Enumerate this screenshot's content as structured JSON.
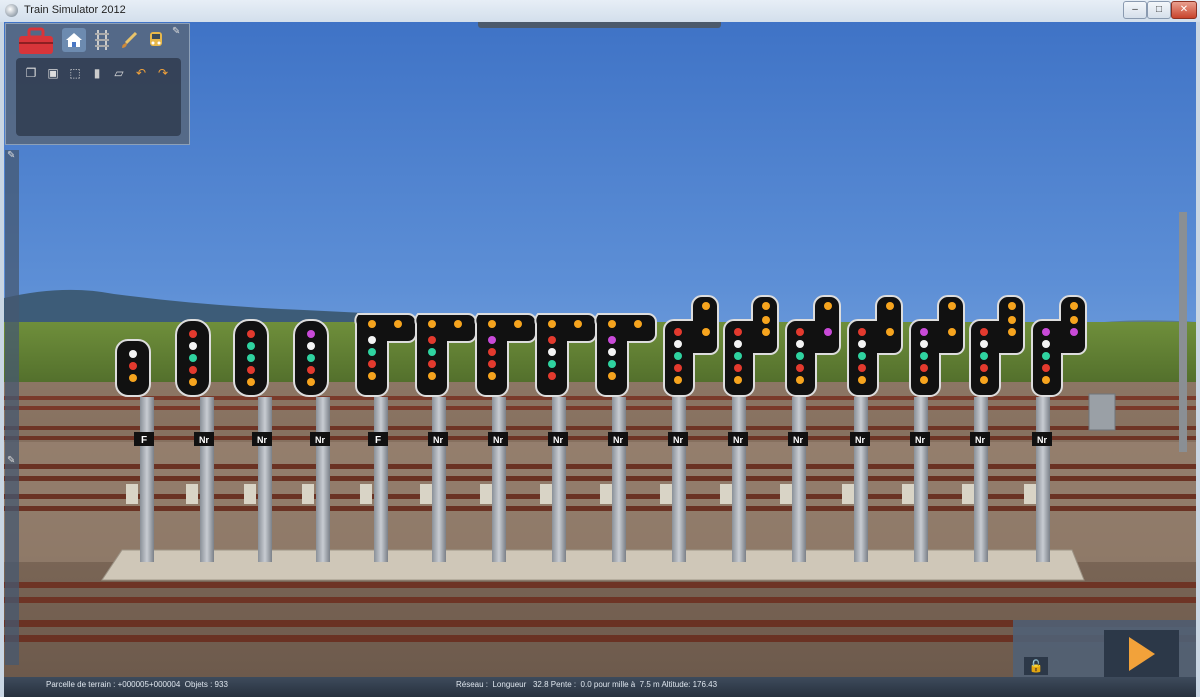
{
  "window": {
    "title": "Train Simulator 2012",
    "minimize": "–",
    "maximize": "□",
    "close": "✕"
  },
  "toolbar": {
    "main_icons": [
      "toolbox-icon",
      "home-icon",
      "track-icon",
      "paintbrush-icon",
      "train-icon"
    ],
    "tool_icons": [
      "copy-icon",
      "paste-icon",
      "select-icon",
      "delete-icon",
      "eraser-icon",
      "undo-icon",
      "redo-icon"
    ]
  },
  "signals": {
    "plates": [
      "F",
      "Nr",
      "Nr",
      "Nr",
      "F",
      "Nr",
      "Nr",
      "Nr",
      "Nr",
      "Nr",
      "Nr",
      "Nr",
      "Nr",
      "Nr",
      "Nr",
      "Nr"
    ]
  },
  "statusbar": {
    "parcel": "Parcelle de terrain : +000005+000004  Objets : 933",
    "network": "Réseau :  Longueur   32.8 Pente :  0.0 pour mille à  7.5 m Altitude: 176.43"
  },
  "colors": {
    "accent_play": "#f2a23a",
    "toolbox_red": "#d8353a"
  }
}
